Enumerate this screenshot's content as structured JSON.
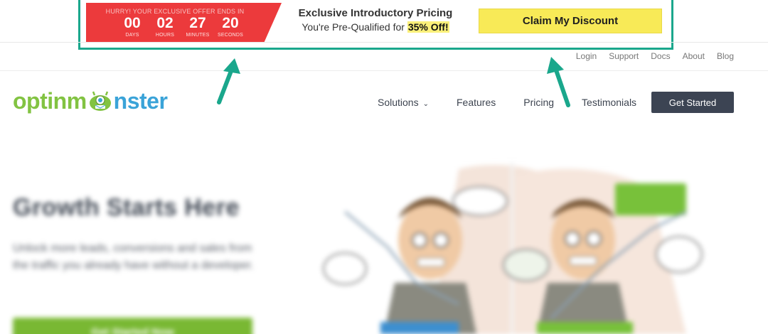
{
  "floating_bar": {
    "hurry_text": "HURRY! YOUR EXCLUSIVE OFFER ENDS IN",
    "countdown": [
      {
        "value": "00",
        "label": "DAYS"
      },
      {
        "value": "02",
        "label": "HOURS"
      },
      {
        "value": "27",
        "label": "MINUTES"
      },
      {
        "value": "20",
        "label": "SECONDS"
      }
    ],
    "offer_title": "Exclusive Introductory Pricing",
    "offer_sub_prefix": "You're Pre-Qualified for ",
    "offer_sub_highlight": "35% Off!",
    "claim_button": "Claim My Discount",
    "colors": {
      "countdown_bg": "#ec3a3c",
      "button_bg": "#f8ea57",
      "frame": "#1aa78c"
    }
  },
  "top_links": [
    "Login",
    "Support",
    "Docs",
    "About",
    "Blog"
  ],
  "header": {
    "logo_part1": "optinm",
    "logo_part2": "nster",
    "nav": [
      "Solutions",
      "Features",
      "Pricing",
      "Testimonials"
    ],
    "cta": "Get Started"
  },
  "hero": {
    "title": "Growth Starts Here",
    "subtitle": "Unlock more leads, conversions and sales from the traffic you already have without a developer.",
    "cta": "Get Started Now"
  }
}
